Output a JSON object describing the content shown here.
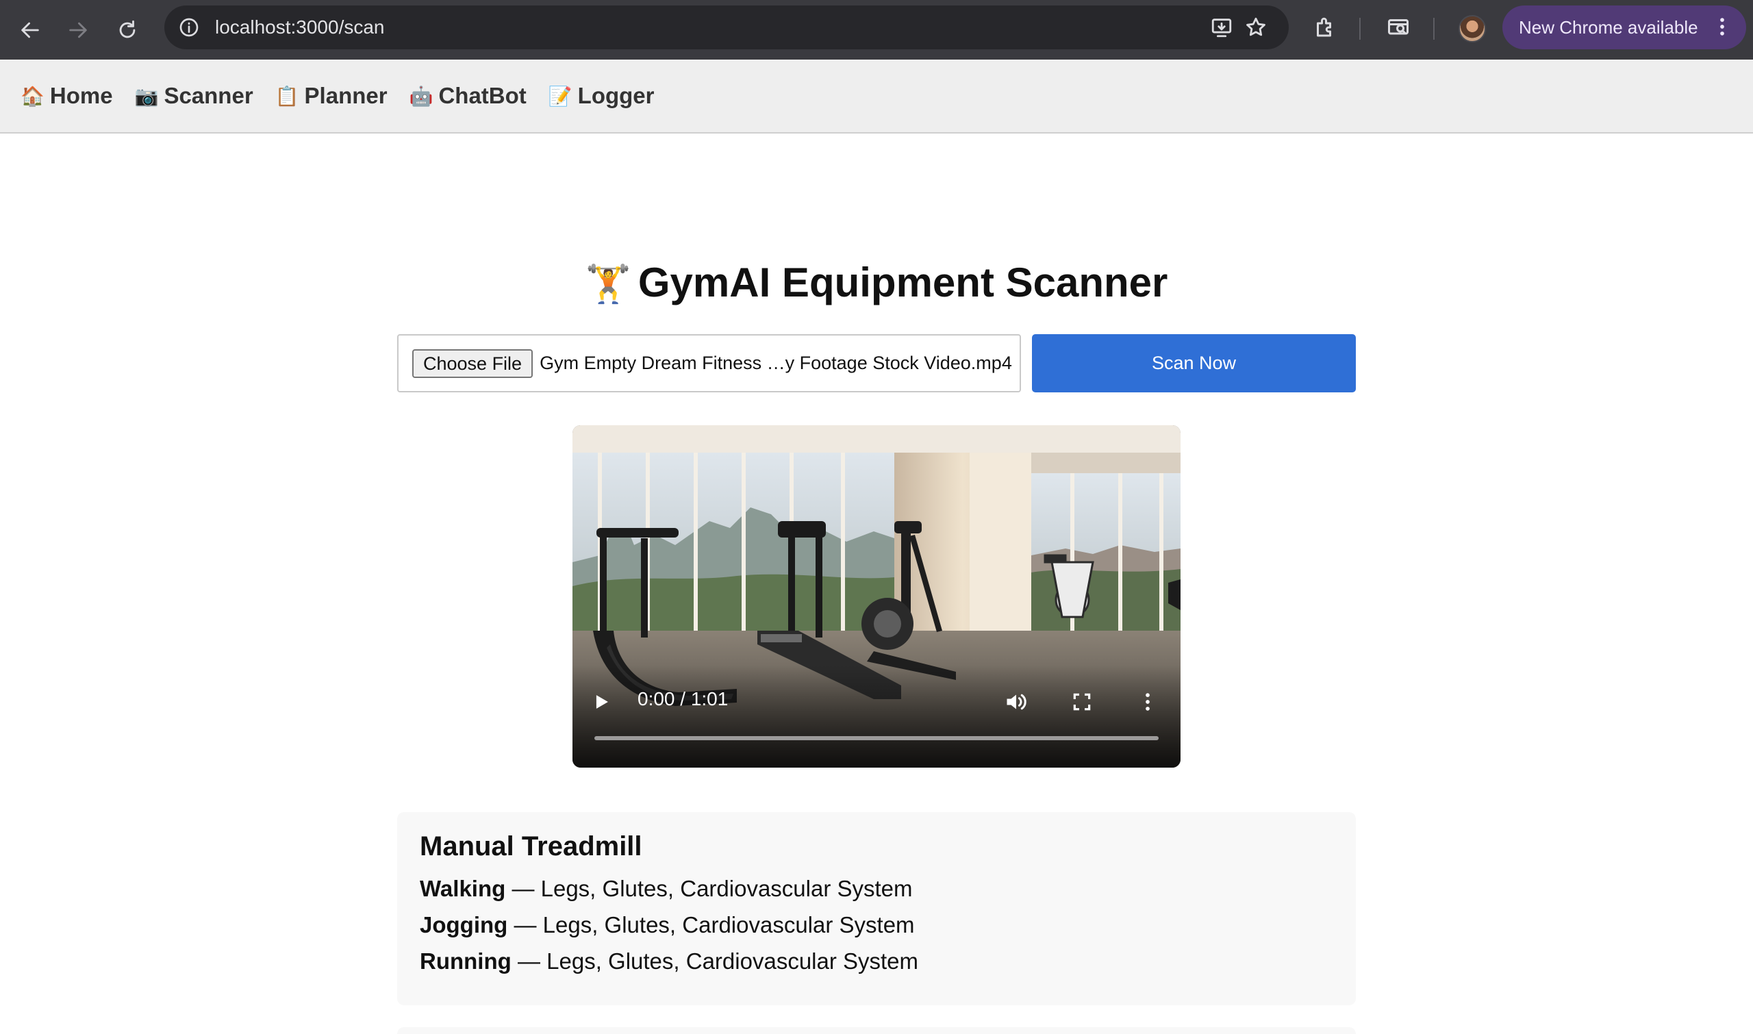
{
  "browser": {
    "url": "localhost:3000/scan",
    "update_label": "New Chrome available"
  },
  "nav": {
    "items": [
      {
        "emoji": "🏠",
        "label": "Home"
      },
      {
        "emoji": "📷",
        "label": "Scanner"
      },
      {
        "emoji": "📋",
        "label": "Planner"
      },
      {
        "emoji": "🤖",
        "label": "ChatBot"
      },
      {
        "emoji": "📝",
        "label": "Logger"
      }
    ]
  },
  "page": {
    "title_emoji": "🏋",
    "title": "GymAI Equipment Scanner"
  },
  "upload": {
    "choose_label": "Choose File",
    "file_name": "Gym Empty Dream Fitness …y Footage Stock Video.mp4",
    "scan_label": "Scan Now"
  },
  "video": {
    "time": "0:00 / 1:01",
    "progress": 0
  },
  "result": {
    "equipment": "Manual Treadmill",
    "exercises": [
      {
        "name": "Walking",
        "muscles": "Legs, Glutes, Cardiovascular System"
      },
      {
        "name": "Jogging",
        "muscles": "Legs, Glutes, Cardiovascular System"
      },
      {
        "name": "Running",
        "muscles": "Legs, Glutes, Cardiovascular System"
      }
    ]
  },
  "colors": {
    "primary": "#2f6fd6",
    "nav_bg": "#eeeeee",
    "card_bg": "#f8f8f8"
  }
}
